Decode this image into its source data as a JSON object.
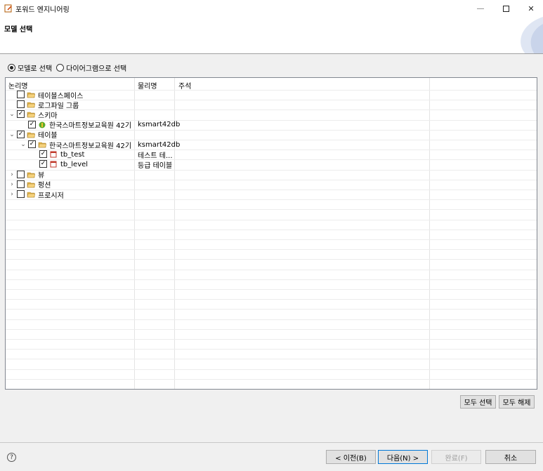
{
  "window": {
    "title": "포워드 엔지니어링",
    "buttons": {
      "minimize": "—",
      "maximize": "☐",
      "close": "✕"
    }
  },
  "header": {
    "title": "모델 선택"
  },
  "radio_options": [
    {
      "label": "모델로 선택",
      "selected": true
    },
    {
      "label": "다이어그램으로 선택",
      "selected": false
    }
  ],
  "table": {
    "columns": [
      "논리명",
      "물리명",
      "주석"
    ],
    "rows": [
      {
        "name": "테이블스페이스",
        "physical": "",
        "checked": false,
        "expander": "",
        "level": 1,
        "icon": "folder-icon"
      },
      {
        "name": "로그파일 그룹",
        "physical": "",
        "checked": false,
        "expander": "",
        "level": 1,
        "icon": "folder-icon"
      },
      {
        "name": "스키마",
        "physical": "",
        "checked": true,
        "expander": "expanded",
        "level": 1,
        "icon": "folder-icon"
      },
      {
        "name": "한국스마트정보교육원 42기",
        "physical": "ksmart42db",
        "checked": true,
        "expander": "",
        "level": 2,
        "icon": "schema-icon"
      },
      {
        "name": "테이블",
        "physical": "",
        "checked": true,
        "expander": "expanded",
        "level": 1,
        "icon": "folder-icon"
      },
      {
        "name": "한국스마트정보교육원 42기",
        "physical": "ksmart42db",
        "checked": true,
        "expander": "expanded",
        "level": 2,
        "icon": "folder-icon"
      },
      {
        "name": "tb_test",
        "physical": "테스트 테...",
        "checked": true,
        "expander": "",
        "level": 3,
        "icon": "table-icon"
      },
      {
        "name": "tb_level",
        "physical": "등급 테이블",
        "checked": true,
        "expander": "",
        "level": 3,
        "icon": "table-icon"
      },
      {
        "name": "뷰",
        "physical": "",
        "checked": false,
        "expander": "collapsed",
        "level": 1,
        "icon": "folder-icon"
      },
      {
        "name": "펑션",
        "physical": "",
        "checked": false,
        "expander": "collapsed",
        "level": 1,
        "icon": "folder-icon"
      },
      {
        "name": "프로시저",
        "physical": "",
        "checked": false,
        "expander": "collapsed",
        "level": 1,
        "icon": "folder-icon"
      }
    ]
  },
  "actions": {
    "select_all": "모두 선택",
    "deselect_all": "모두 해제"
  },
  "footer": {
    "back": "< 이전(B)",
    "next": "다음(N) >",
    "finish": "완료(F)",
    "cancel": "취소",
    "help_icon": "?"
  },
  "colors": {
    "folder": "#e8b84a",
    "table": "#c0392b",
    "accent": "#0078d7",
    "schema": "#5cab2a"
  }
}
